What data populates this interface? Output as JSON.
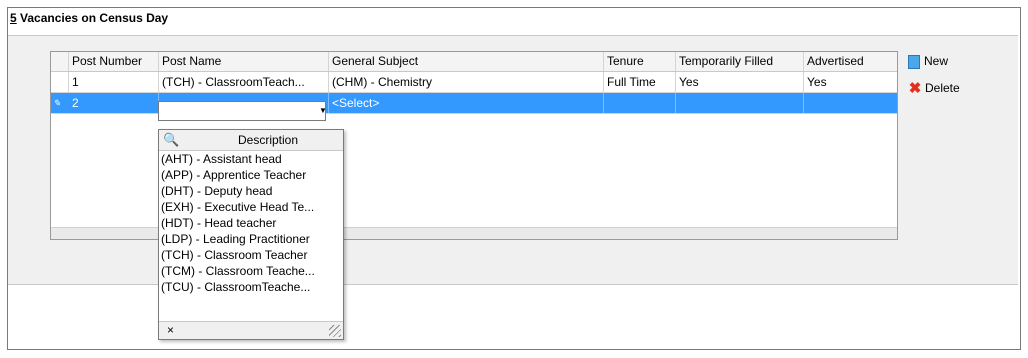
{
  "section": {
    "number": "5",
    "title": "Vacancies on Census Day"
  },
  "grid": {
    "columns": [
      "Post Number",
      "Post Name",
      "General Subject",
      "Tenure",
      "Temporarily Filled",
      "Advertised"
    ],
    "rows": [
      {
        "post_number": "1",
        "post_name": "(TCH) - ClassroomTeach...",
        "general_subject": "(CHM) - Chemistry",
        "tenure": "Full Time",
        "temporarily_filled": "Yes",
        "advertised": "Yes"
      }
    ],
    "edit_row": {
      "indicator": "✎",
      "post_number": "2",
      "post_name": "",
      "general_subject": "<Select>",
      "tenure": "",
      "temporarily_filled": "",
      "advertised": ""
    }
  },
  "dropdown": {
    "header": "Description",
    "items": [
      "(AHT) - Assistant head",
      "(APP) - Apprentice Teacher",
      "(DHT) - Deputy head",
      "(EXH) - Executive Head Te...",
      "(HDT) - Head teacher",
      "(LDP) - Leading Practitioner",
      "(TCH) - Classroom Teacher",
      "(TCM) - Classroom Teache...",
      "(TCU) - ClassroomTeache..."
    ],
    "close_glyph": "×"
  },
  "actions": {
    "new_label": "New",
    "delete_label": "Delete"
  },
  "colors": {
    "selection": "#3399ff",
    "delete_icon": "#e0301e",
    "new_icon": "#4aa8e8"
  }
}
